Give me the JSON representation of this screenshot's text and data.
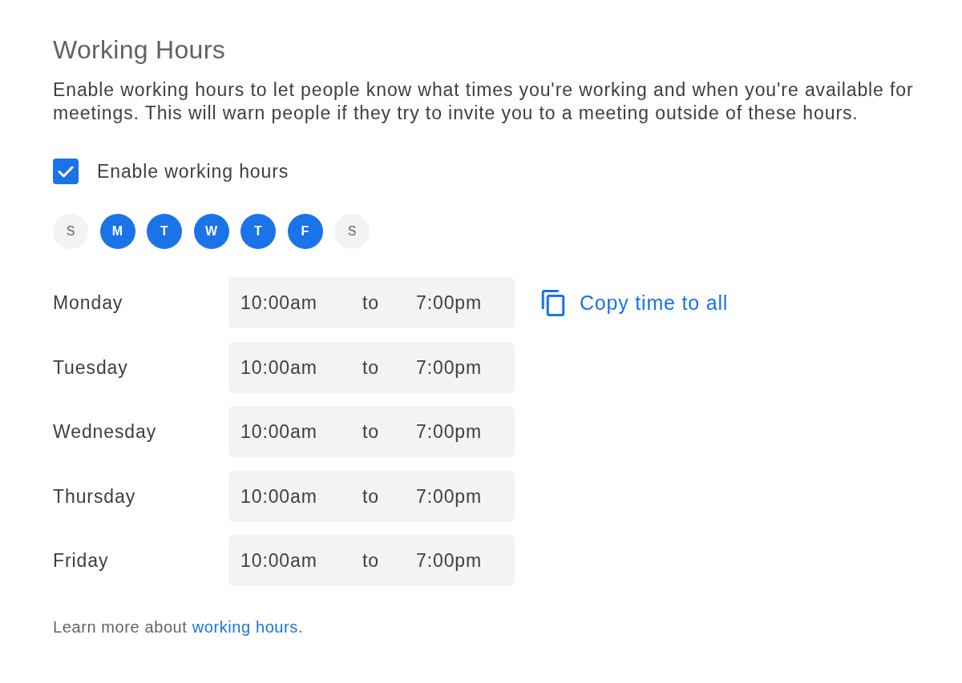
{
  "title": "Working Hours",
  "description": "Enable working hours to let people know what times you're working and when you're available for meetings. This will warn people if they try to invite you to a meeting outside of these hours.",
  "enable": {
    "label": "Enable working hours",
    "checked": true
  },
  "days": [
    {
      "letter": "S",
      "selected": false
    },
    {
      "letter": "M",
      "selected": true
    },
    {
      "letter": "T",
      "selected": true
    },
    {
      "letter": "W",
      "selected": true
    },
    {
      "letter": "T",
      "selected": true
    },
    {
      "letter": "F",
      "selected": true
    },
    {
      "letter": "S",
      "selected": false
    }
  ],
  "schedule": [
    {
      "day": "Monday",
      "start": "10:00am",
      "separator": "to",
      "end": "7:00pm"
    },
    {
      "day": "Tuesday",
      "start": "10:00am",
      "separator": "to",
      "end": "7:00pm"
    },
    {
      "day": "Wednesday",
      "start": "10:00am",
      "separator": "to",
      "end": "7:00pm"
    },
    {
      "day": "Thursday",
      "start": "10:00am",
      "separator": "to",
      "end": "7:00pm"
    },
    {
      "day": "Friday",
      "start": "10:00am",
      "separator": "to",
      "end": "7:00pm"
    }
  ],
  "copy_button": {
    "label": "Copy time to all"
  },
  "footer": {
    "text": "Learn more about ",
    "link": "working hours",
    "suffix": "."
  }
}
